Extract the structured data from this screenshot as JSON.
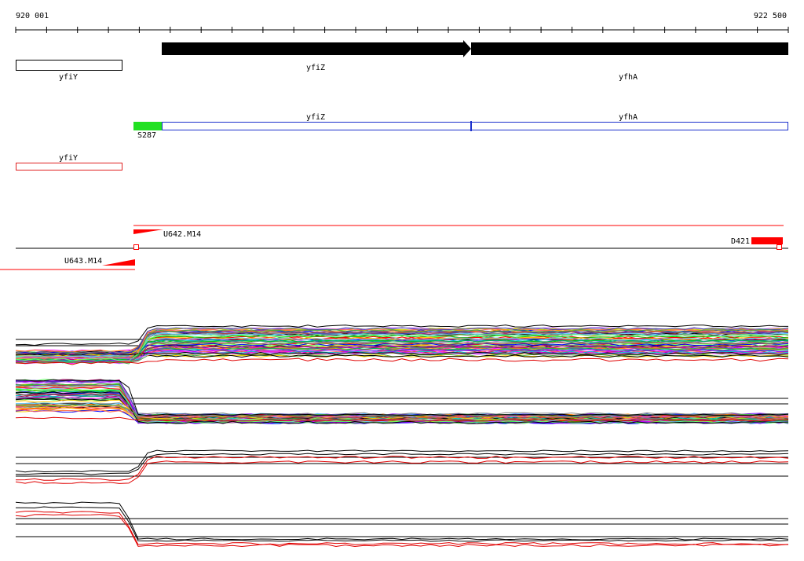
{
  "axis": {
    "start_label": "920 001",
    "end_label": "922 500",
    "start": 920001,
    "end": 922500,
    "tick_count": 25
  },
  "genes": [
    {
      "name": "yfiY",
      "start": 920001,
      "end": 920345,
      "strand": "none",
      "style": "outline-black"
    },
    {
      "name": "yfiZ",
      "start": 920470,
      "end": 921470,
      "strand": "+",
      "style": "arrow-black"
    },
    {
      "name": "yfhA",
      "start": 921470,
      "end": 922500,
      "strand": "+",
      "style": "bar-black"
    }
  ],
  "orfs": [
    {
      "name": "yfiZ",
      "start": 920470,
      "end": 921470,
      "color": "#1a2fcc"
    },
    {
      "name": "yfhA",
      "start": 921470,
      "end": 922500,
      "color": "#1a2fcc"
    }
  ],
  "features": [
    {
      "name": "S287",
      "start": 920380,
      "end": 920470,
      "color": "#22e022"
    },
    {
      "name": "yfiY",
      "start": 920001,
      "end": 920345,
      "color": "#e02020"
    }
  ],
  "transcripts": [
    {
      "name": "U642.M14",
      "start": 920380,
      "end": 922475,
      "color": "#ff0000"
    },
    {
      "name": "U643.M14",
      "start": 919950,
      "end": 920380,
      "color": "#ff0000"
    },
    {
      "name": "D421",
      "start": 922390,
      "end": 922490,
      "color": "#ff0000"
    }
  ],
  "colors": {
    "accent_red": "#ff0000",
    "gene_blue": "#1a2fcc",
    "start_green": "#22e022"
  }
}
